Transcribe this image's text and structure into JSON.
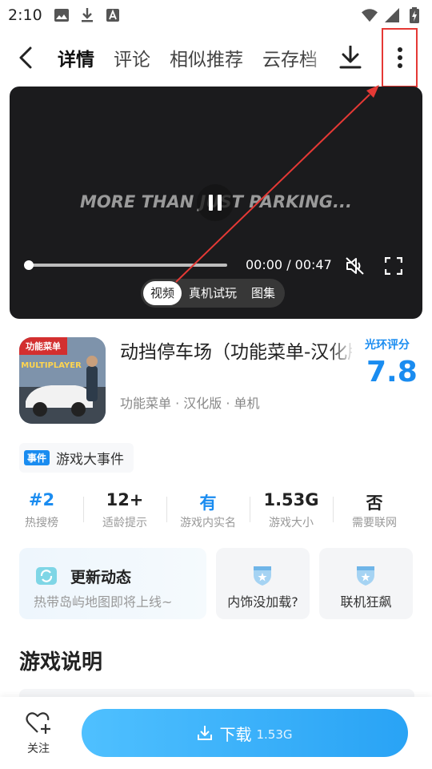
{
  "status_bar": {
    "time": "2:10",
    "left_icons": [
      "image-icon",
      "download-icon",
      "font-icon"
    ],
    "right_icons": [
      "wifi-icon",
      "signal-icon",
      "battery-charging-icon"
    ]
  },
  "nav": {
    "tabs": [
      "详情",
      "评论",
      "相似推荐",
      "云存档"
    ],
    "active_tab": "详情",
    "actions": [
      "download-icon",
      "more-vertical-icon"
    ]
  },
  "video": {
    "caption": "MORE THAN JUST PARKING...",
    "time": "00:00 / 00:47",
    "progress": 0.0,
    "media_tabs": [
      "视频",
      "真机试玩",
      "图集"
    ],
    "active_media_tab": "视频"
  },
  "app": {
    "icon_badge": "功能菜单",
    "icon_text": "MULTIPLAYER",
    "title": "动挡停车场（功能菜单-汉化版）",
    "tags": "功能菜单 · 汉化版 · 单机",
    "rating_label": "光环评分",
    "rating_value": "7.8"
  },
  "event": {
    "badge": "事件",
    "text": "游戏大事件"
  },
  "stats": [
    {
      "value": "#2",
      "label": "热搜榜"
    },
    {
      "value": "12+",
      "label": "适龄提示"
    },
    {
      "value": "有",
      "label": "游戏内实名"
    },
    {
      "value": "1.53G",
      "label": "游戏大小"
    },
    {
      "value": "否",
      "label": "需要联网"
    }
  ],
  "cards": {
    "update_title": "更新动态",
    "update_sub": "热带岛屿地图即将上线~",
    "card2": "内饰没加载?",
    "card3": "联机狂飙"
  },
  "section_title": "游戏说明",
  "bottom": {
    "follow_label": "关注",
    "download_label": "下载",
    "download_size": "1.53G"
  },
  "colors": {
    "accent": "#1a8cf0",
    "download_button": "#29a3f5",
    "annotation": "#e53935"
  }
}
